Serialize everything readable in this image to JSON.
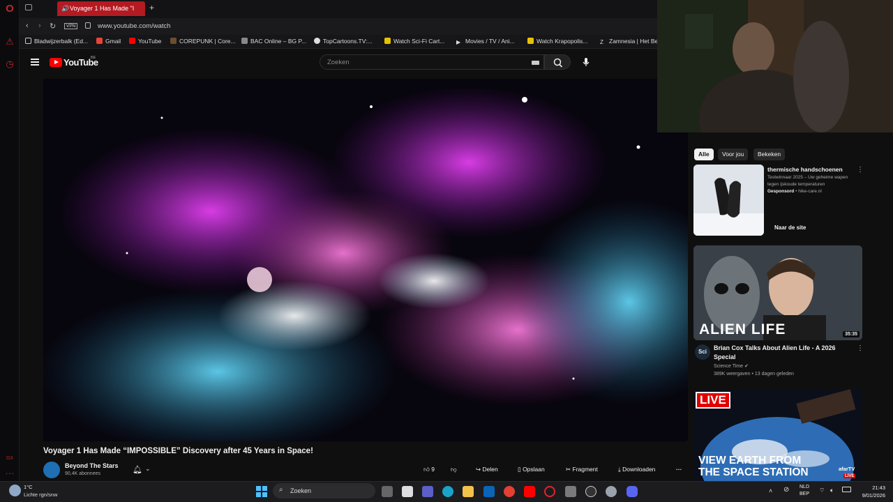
{
  "browser": {
    "tab_title": "Voyager 1 Has Made \"I",
    "url": "www.youtube.com/watch",
    "vpn": "VPN",
    "bookmarks": [
      "Bladwijzerbalk (Ed...",
      "Gmail",
      "YouTube",
      "COREPUNK | Core...",
      "BAC Online – BG P...",
      "TopCartoons.TV:...",
      "Watch Sci-Fi Cart...",
      "Movies / TV / Ani...",
      "Watch Krapopolis...",
      "Zamnesia | Het Be"
    ]
  },
  "youtube": {
    "logo": "YouTube",
    "country": "BE",
    "search_placeholder": "Zoeken"
  },
  "video": {
    "title": "Voyager 1 Has Made “IMPOSSIBLE” Discovery after 45 Years in Space!",
    "channel": "Beyond The Stars",
    "subscribers": "90,4K abonnees",
    "likes": "9",
    "share": "Delen",
    "save": "Opslaan",
    "clip": "Fragment",
    "download": "Downloaden"
  },
  "sidebar": {
    "chips": [
      "Alle",
      "Voor jou",
      "Bekeken"
    ],
    "ad": {
      "title": "thermische handschoenen",
      "desc": "Testwinnaar 2025 – Uw geheime wapen tegen ijskoude temperaturen",
      "sponsored": "Gesponsord",
      "domain": "• hike-care.nl",
      "cta": "Naar de site"
    },
    "videos": [
      {
        "thumb_text": "ALIEN LIFE",
        "duration": "35:35",
        "title": "Brian Cox Talks About Alien Life - A 2026 Special",
        "channel": "Science Time",
        "meta": "389K weergaven • 13 dagen geleden",
        "avatar_text": "Sci"
      },
      {
        "badge": "LIVE",
        "thumb_line1": "VIEW EARTH FROM",
        "thumb_line2": "THE SPACE STATION",
        "corner": "afarTV",
        "corner_badge": "LIVE"
      }
    ]
  },
  "taskbar": {
    "weather_temp": "1°C",
    "weather_desc": "Lichte rgn/snw",
    "search": "Zoeken",
    "lang1": "NLD",
    "lang2": "BEP",
    "time": "21:43",
    "date": "9/01/2026"
  },
  "colors": {
    "accent": "#ff0000",
    "opera": "#c0262d",
    "bg": "#0f0f0f"
  }
}
